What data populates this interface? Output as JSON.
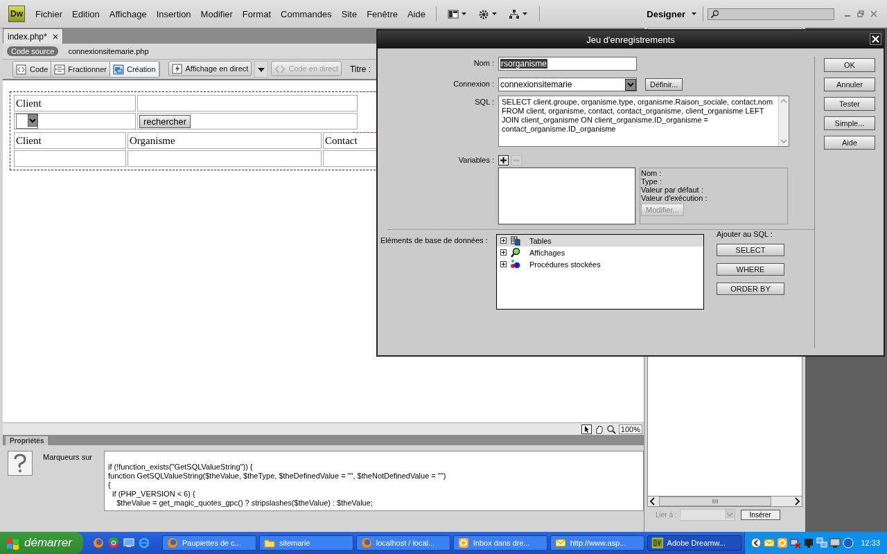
{
  "app": {
    "logo": "Dw",
    "menu": [
      "Fichier",
      "Edition",
      "Affichage",
      "Insertion",
      "Modifier",
      "Format",
      "Commandes",
      "Site",
      "Fenêtre",
      "Aide"
    ],
    "workspace": "Designer"
  },
  "document": {
    "tabs": [
      {
        "label": "index.php*",
        "selected": true
      }
    ],
    "related_files": [
      {
        "label": "Code source",
        "selected": true
      },
      {
        "label": "connexionsitemarie.php",
        "selected": false
      }
    ],
    "view_buttons": [
      {
        "label": "Code",
        "selected": false
      },
      {
        "label": "Fractionner",
        "selected": false
      },
      {
        "label": "Création",
        "selected": true
      }
    ],
    "live_buttons": [
      {
        "label": "Affichage en direct",
        "disabled": false
      },
      {
        "label": "Code en direct",
        "disabled": true
      }
    ],
    "title_label": "Titre :"
  },
  "design": {
    "search_form": {
      "label": "Client",
      "button": "rechercher"
    },
    "results_table": {
      "columns": [
        "Client",
        "Organisme",
        "Contact"
      ]
    }
  },
  "status_bar": {
    "zoom": "100%"
  },
  "properties": {
    "title": "Propriétés",
    "label": "Marqueurs sur",
    "code": [
      "if (!function_exists(\"GetSQLValueString\")) {",
      "function GetSQLValueString($theValue, $theType, $theDefinedValue = \"\", $theNotDefinedValue = \"\")",
      "{",
      "  if (PHP_VERSION < 6) {",
      "    $theValue = get_magic_quotes_gpc() ? stripslashes($theValue) : $theValue;"
    ]
  },
  "side_panel": {
    "link_label": "Lier à :",
    "link_disabled": true,
    "insert_button": "Insérer"
  },
  "dialog": {
    "title": "Jeu d'enregistrements",
    "name_label": "Nom :",
    "name_value": "rsorganisme",
    "connection_label": "Connexion :",
    "connection_value": "connexionsitemarie",
    "define_button": "Définir...",
    "sql_label": "SQL :",
    "sql": "SELECT client.groupe, organisme.type, organisme.Raison_sociale, contact.nom FROM client, organisme, contact, contact_organisme, client_organisme LEFT JOIN client_organisme ON client_organisme.ID_organisme = contact_organisme.ID_organisme",
    "variables_label": "Variables :",
    "variable_details": [
      "Nom :",
      "Type :",
      "Valeur par défaut :",
      "Valeur d'exécution :"
    ],
    "modify_button": "Modifier...",
    "db_label": "Eléments de base de données :",
    "db_tree": [
      {
        "label": "Tables",
        "kind": "tables",
        "selected": true
      },
      {
        "label": "Affichages",
        "kind": "views",
        "selected": false
      },
      {
        "label": "Procédures stockées",
        "kind": "procedures",
        "selected": false
      }
    ],
    "add_label": "Ajouter au SQL :",
    "add_buttons": [
      "SELECT",
      "WHERE",
      "ORDER BY"
    ],
    "buttons": [
      "OK",
      "Annuler",
      "Tester",
      "Simple...",
      "Aide"
    ]
  },
  "taskbar": {
    "start": "démarrer",
    "tasks": [
      {
        "label": "Paupiettes de c...",
        "kind": "browser",
        "selected": false
      },
      {
        "label": "sitemarie",
        "kind": "folder",
        "selected": false
      },
      {
        "label": "localhost / local...",
        "kind": "browser",
        "selected": false
      },
      {
        "label": "Inbox dans dre...",
        "kind": "mail-app",
        "selected": false
      },
      {
        "label": "http://www.asp...",
        "kind": "mail",
        "selected": false
      },
      {
        "label": "Adobe Dreamw...",
        "kind": "app",
        "selected": true
      }
    ],
    "clock": "12:33"
  }
}
